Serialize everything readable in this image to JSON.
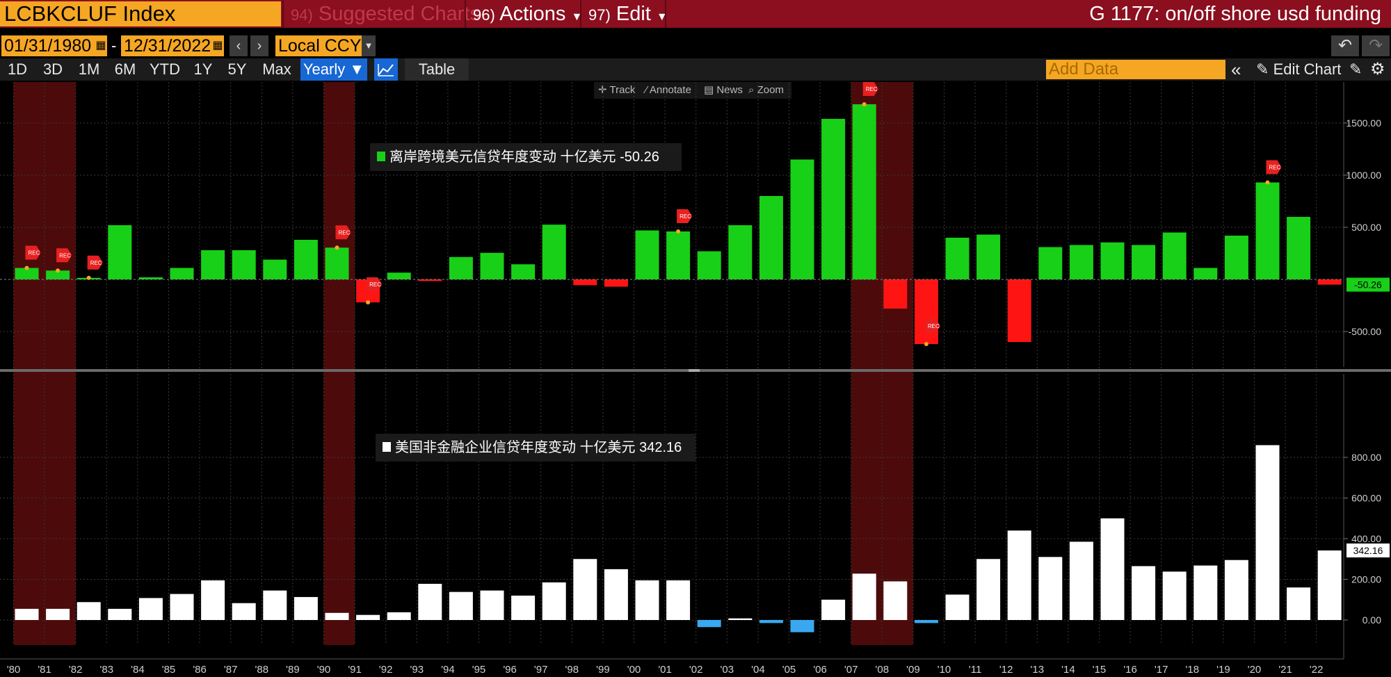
{
  "header": {
    "ticker": "LCBKCLUF Index",
    "menu": [
      {
        "num": "94)",
        "label": "Suggested Charts"
      },
      {
        "num": "96)",
        "label": "Actions"
      },
      {
        "num": "97)",
        "label": "Edit"
      }
    ],
    "title": "G 1177: on/off shore usd funding"
  },
  "toolbar": {
    "start_date": "01/31/1980",
    "dash": "-",
    "end_date": "12/31/2022",
    "currency": "Local CCY",
    "periods": [
      "1D",
      "3D",
      "1M",
      "6M",
      "YTD",
      "1Y",
      "5Y",
      "Max"
    ],
    "frequency": "Yearly ▼",
    "table_label": "Table",
    "add_data_placeholder": "Add Data",
    "edit_chart_label": "Edit Chart",
    "tools": [
      "Track",
      "Annotate",
      "News",
      "Zoom"
    ]
  },
  "colors": {
    "positive_top": "#18d018",
    "negative_top": "#ff1414",
    "positive_bottom": "#ffffff",
    "negative_bottom": "#3aa8f0",
    "recession_band": "#5a0c0c",
    "header_bg": "#8b0f1f",
    "field_bg": "#f5a623"
  },
  "chart_data": [
    {
      "type": "bar",
      "title": "离岸跨境美元信贷年度变动 十亿美元 -50.26",
      "legend_label": "离岸跨境美元信贷年度变动 十亿美元 -50.26",
      "last_value_label": "-50.26",
      "yticks": [
        1500,
        1000,
        500,
        -500
      ],
      "ytick_labels": [
        "1500.00",
        "1000.00",
        "500.00",
        "-500.00"
      ],
      "ylim": [
        -900,
        1900
      ],
      "categories": [
        1980,
        1981,
        1982,
        1983,
        1984,
        1985,
        1986,
        1987,
        1988,
        1989,
        1990,
        1991,
        1992,
        1993,
        1994,
        1995,
        1996,
        1997,
        1998,
        1999,
        2000,
        2001,
        2002,
        2003,
        2004,
        2005,
        2006,
        2007,
        2008,
        2009,
        2010,
        2011,
        2012,
        2013,
        2014,
        2015,
        2016,
        2017,
        2018,
        2019,
        2020,
        2021,
        2022
      ],
      "values": [
        110,
        85,
        15,
        520,
        20,
        110,
        280,
        280,
        190,
        380,
        305,
        -220,
        65,
        -15,
        215,
        255,
        145,
        525,
        -55,
        -70,
        470,
        460,
        270,
        520,
        800,
        1150,
        1540,
        1680,
        -280,
        -620,
        400,
        430,
        -600,
        310,
        330,
        355,
        330,
        450,
        110,
        420,
        930,
        600,
        -50.26
      ],
      "recession_flags": [
        1980,
        1981,
        1982,
        1990,
        1991,
        2001,
        2007,
        2009,
        2020
      ],
      "grid": true
    },
    {
      "type": "bar",
      "title": "美国非金融企业信贷年度变动 十亿美元 342.16",
      "legend_label": "美国非金融企业信贷年度变动 十亿美元 342.16",
      "last_value_label": "342.16",
      "yticks": [
        800,
        600,
        400,
        200,
        0
      ],
      "ytick_labels": [
        "800.00",
        "600.00",
        "400.00",
        "200.00",
        "0.00"
      ],
      "ylim": [
        -160,
        950
      ],
      "categories": [
        1980,
        1981,
        1982,
        1983,
        1984,
        1985,
        1986,
        1987,
        1988,
        1989,
        1990,
        1991,
        1992,
        1993,
        1994,
        1995,
        1996,
        1997,
        1998,
        1999,
        2000,
        2001,
        2002,
        2003,
        2004,
        2005,
        2006,
        2007,
        2008,
        2009,
        2010,
        2011,
        2012,
        2013,
        2014,
        2015,
        2016,
        2017,
        2018,
        2019,
        2020,
        2021,
        2022
      ],
      "values": [
        55,
        55,
        88,
        55,
        108,
        128,
        195,
        83,
        145,
        113,
        35,
        25,
        38,
        178,
        138,
        145,
        120,
        185,
        300,
        250,
        195,
        195,
        -35,
        8,
        -15,
        -60,
        100,
        228,
        190,
        -15,
        125,
        300,
        440,
        310,
        385,
        500,
        265,
        238,
        268,
        295,
        860,
        160,
        342.16
      ],
      "grid": true
    }
  ],
  "recessions": [
    {
      "start": 1980,
      "end": 1981
    },
    {
      "start": 1990,
      "end": 1990
    },
    {
      "start": 2007,
      "end": 2008
    }
  ],
  "x_tick_labels": [
    "'80",
    "'81",
    "'82",
    "'83",
    "'84",
    "'85",
    "'86",
    "'87",
    "'88",
    "'89",
    "'90",
    "'91",
    "'92",
    "'93",
    "'94",
    "'95",
    "'96",
    "'97",
    "'98",
    "'99",
    "'00",
    "'01",
    "'02",
    "'03",
    "'04",
    "'05",
    "'06",
    "'07",
    "'08",
    "'09",
    "'10",
    "'11",
    "'12",
    "'13",
    "'14",
    "'15",
    "'16",
    "'17",
    "'18",
    "'19",
    "'20",
    "'21",
    "'22"
  ],
  "rec_flag_text": "REC"
}
